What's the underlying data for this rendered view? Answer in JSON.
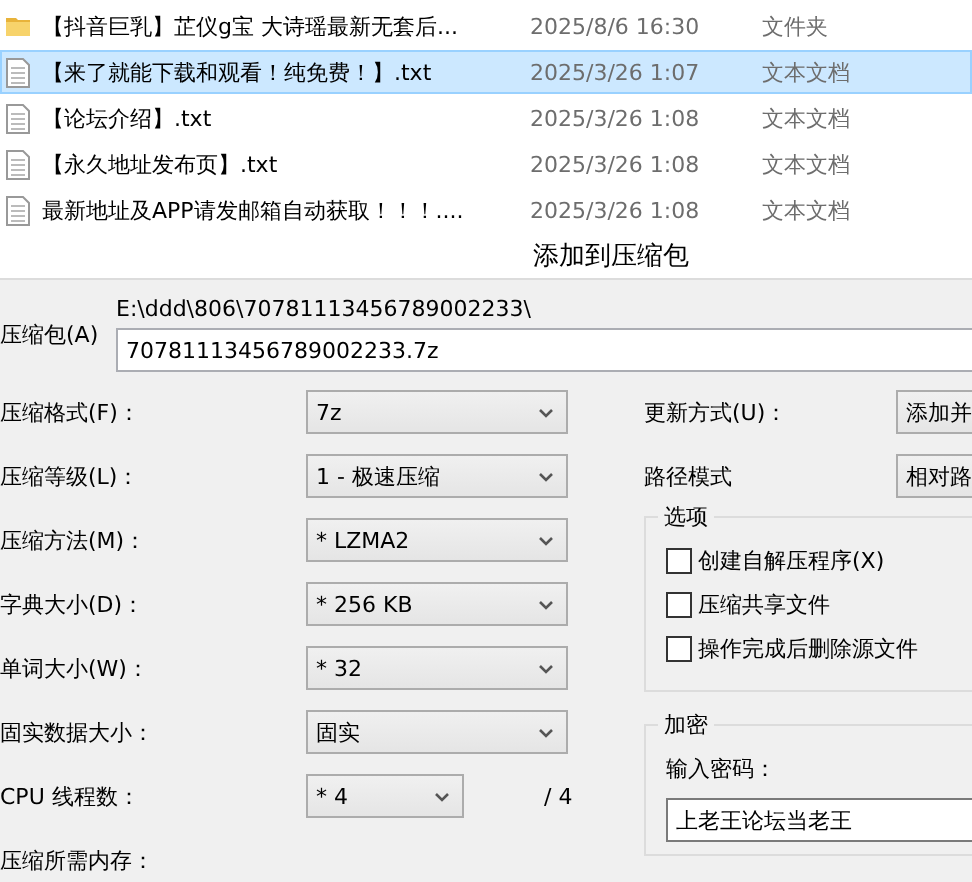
{
  "files": [
    {
      "name": "【抖音巨乳】芷仪g宝 大诗瑶最新无套后...",
      "date": "2025/8/6 16:30",
      "type": "文件夹",
      "kind": "folder",
      "selected": false
    },
    {
      "name": "【来了就能下载和观看！纯免费！】.txt",
      "date": "2025/3/26 1:07",
      "type": "文本文档",
      "kind": "text",
      "selected": true
    },
    {
      "name": "【论坛介绍】.txt",
      "date": "2025/3/26 1:08",
      "type": "文本文档",
      "kind": "text",
      "selected": false
    },
    {
      "name": "【永久地址发布页】.txt",
      "date": "2025/3/26 1:08",
      "type": "文本文档",
      "kind": "text",
      "selected": false
    },
    {
      "name": "最新地址及APP请发邮箱自动获取！！！....",
      "date": "2025/3/26 1:08",
      "type": "文本文档",
      "kind": "text",
      "selected": false
    }
  ],
  "dialog": {
    "title": "添加到压缩包",
    "archive_label": "压缩包(A)",
    "path": "E:\\ddd\\806\\70781113456789002233\\",
    "archive_name": "70781113456789002233.7z",
    "fields": [
      {
        "label": "压缩格式(F)：",
        "value": "7z",
        "kind": "select"
      },
      {
        "label": "压缩等级(L)：",
        "value": "1 - 极速压缩",
        "kind": "select"
      },
      {
        "label": "压缩方法(M)：",
        "value": "* LZMA2",
        "kind": "select"
      },
      {
        "label": "字典大小(D)：",
        "value": "* 256 KB",
        "kind": "select"
      },
      {
        "label": "单词大小(W)：",
        "value": "* 32",
        "kind": "select"
      },
      {
        "label": "固实数据大小：",
        "value": "固实",
        "kind": "select"
      },
      {
        "label": "CPU 线程数：",
        "value": "* 4",
        "suffix": "/ 4",
        "kind": "narrow"
      },
      {
        "label": "压缩所需内存：",
        "kind": "label"
      }
    ],
    "update_label": "更新方式(U)：",
    "update_value": "添加并",
    "path_mode_label": "路径模式",
    "path_mode_value": "相对路",
    "options_legend": "选项",
    "options": [
      {
        "label": "创建自解压程序(X)",
        "checked": false
      },
      {
        "label": "压缩共享文件",
        "checked": false
      },
      {
        "label": "操作完成后删除源文件",
        "checked": false
      }
    ],
    "encryption_legend": "加密",
    "password_label": "输入密码：",
    "password_value": "上老王论坛当老王"
  }
}
